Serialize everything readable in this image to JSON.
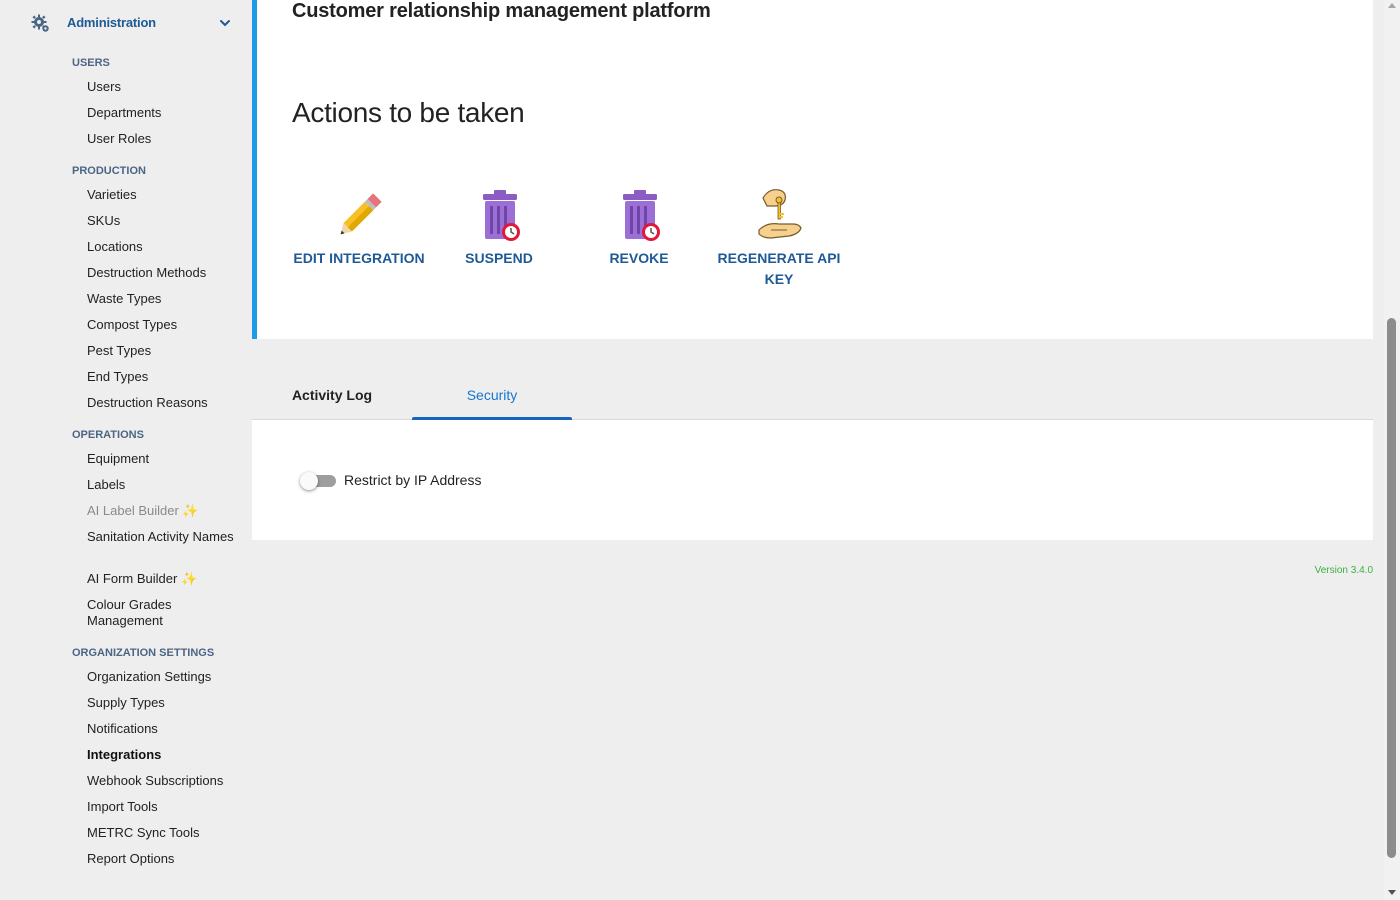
{
  "sidebar": {
    "admin_label": "Administration",
    "sections": [
      {
        "title": "USERS",
        "items": [
          "Users",
          "Departments",
          "User Roles"
        ]
      },
      {
        "title": "PRODUCTION",
        "items": [
          "Varieties",
          "SKUs",
          "Locations",
          "Destruction Methods",
          "Waste Types",
          "Compost Types",
          "Pest Types",
          "End Types",
          "Destruction Reasons"
        ]
      },
      {
        "title": "OPERATIONS",
        "items": [
          "Equipment",
          "Labels",
          "AI Label Builder",
          "Sanitation Activity Names",
          "AI Form Builder",
          "Colour Grades Management"
        ]
      },
      {
        "title": "ORGANIZATION SETTINGS",
        "items": [
          "Organization Settings",
          "Supply Types",
          "Notifications",
          "Integrations",
          "Webhook Subscriptions",
          "Import Tools",
          "METRC Sync Tools",
          "Report Options"
        ]
      }
    ],
    "active_item": "Integrations",
    "sparkle": "✨"
  },
  "main": {
    "title": "Customer relationship management platform",
    "actions_title": "Actions to be taken",
    "actions": [
      {
        "label": "EDIT INTEGRATION",
        "icon": "pencil-icon"
      },
      {
        "label": "SUSPEND",
        "icon": "trash-clock-icon"
      },
      {
        "label": "REVOKE",
        "icon": "trash-clock-icon"
      },
      {
        "label": "REGENERATE API KEY",
        "icon": "hand-key-icon"
      }
    ]
  },
  "tabs": [
    {
      "label": "Activity Log",
      "active": false
    },
    {
      "label": "Security",
      "active": true
    }
  ],
  "security": {
    "toggle_label": "Restrict by IP Address",
    "toggle_on": false
  },
  "footer": {
    "version": "Version 3.4.0"
  },
  "colors": {
    "accent": "#1e9be6",
    "link": "#1f5a96",
    "tab_active": "#1976d2",
    "version": "#3cb043"
  }
}
